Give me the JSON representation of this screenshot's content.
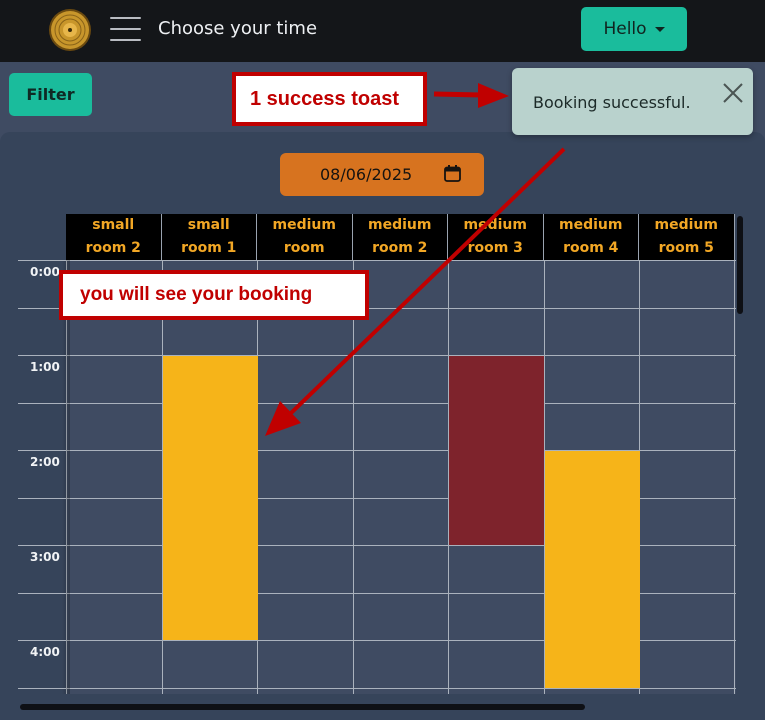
{
  "navbar": {
    "logo_icon": "vinyl-record-icon",
    "menu_icon": "hamburger-menu-icon",
    "title": "Choose your time",
    "user_button": "Hello",
    "accent": "#1abc9c"
  },
  "filter_button": "Filter",
  "date_picker": {
    "value": "08/06/2025",
    "icon": "calendar-icon",
    "color": "#d7731f"
  },
  "rooms": [
    {
      "line1": "small",
      "line2": "room 2"
    },
    {
      "line1": "small",
      "line2": "room 1"
    },
    {
      "line1": "medium",
      "line2": "room"
    },
    {
      "line1": "medium",
      "line2": "room 2"
    },
    {
      "line1": "medium",
      "line2": "room 3"
    },
    {
      "line1": "medium",
      "line2": "room 4"
    },
    {
      "line1": "medium",
      "line2": "room 5"
    }
  ],
  "time_labels": [
    "0:00",
    "1:00",
    "2:00",
    "3:00",
    "4:00"
  ],
  "bookings": [
    {
      "room": "small room 1",
      "start": "1:00",
      "end": "4:00",
      "status": "your booking",
      "color": "#f6b419"
    },
    {
      "room": "medium room 3",
      "start": "1:00",
      "end": "3:00",
      "status": "booked",
      "color": "#7e232c"
    },
    {
      "room": "medium room 4",
      "start": "2:00",
      "end": "4:30",
      "status": "your booking",
      "color": "#f6b419"
    }
  ],
  "toast": {
    "message": "Booking successful.",
    "close_icon": "close-icon"
  },
  "annotations": {
    "toast_note": "1 success toast",
    "booking_note": "you will see your booking",
    "color": "#c00000"
  }
}
